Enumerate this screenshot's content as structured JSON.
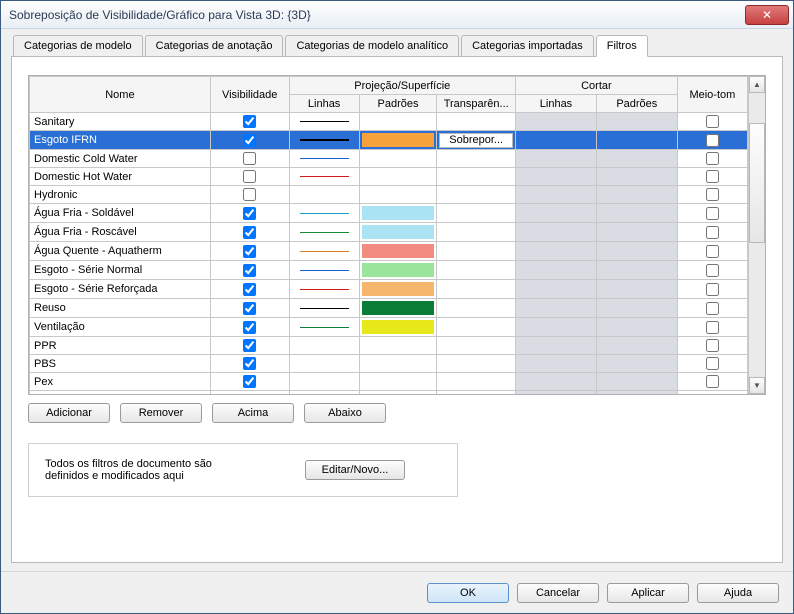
{
  "window": {
    "title": "Sobreposição de Visibilidade/Gráfico para Vista 3D: {3D}",
    "close": "✕"
  },
  "tabs": [
    {
      "label": "Categorias de modelo"
    },
    {
      "label": "Categorias de anotação"
    },
    {
      "label": "Categorias de modelo analítico"
    },
    {
      "label": "Categorias importadas"
    },
    {
      "label": "Filtros"
    }
  ],
  "columns": {
    "name": "Nome",
    "visibility": "Visibilidade",
    "projection": "Projeção/Superfície",
    "proj_lines": "Linhas",
    "proj_patterns": "Padrões",
    "proj_transp": "Transparên...",
    "cut": "Cortar",
    "cut_lines": "Linhas",
    "cut_patterns": "Padrões",
    "halftone": "Meio-tom"
  },
  "override_label": "Sobrepor...",
  "rows": [
    {
      "name": "Sanitary",
      "vis": true,
      "line": "#000000",
      "pattern": null,
      "half": false,
      "selected": false
    },
    {
      "name": "Esgoto IFRN",
      "vis": true,
      "line": "#000000",
      "pattern": "#f6a23a",
      "half": false,
      "selected": true,
      "line_thick": true
    },
    {
      "name": "Domestic Cold Water",
      "vis": false,
      "line": "#1560d6",
      "pattern": null,
      "half": false,
      "selected": false
    },
    {
      "name": "Domestic Hot Water",
      "vis": false,
      "line": "#d11a1a",
      "pattern": null,
      "half": false,
      "selected": false
    },
    {
      "name": "Hydronic",
      "vis": false,
      "line": null,
      "pattern": null,
      "half": false,
      "selected": false
    },
    {
      "name": "Água Fria - Soldável",
      "vis": true,
      "line": "#14a5c6",
      "pattern": "#a9e3f4",
      "half": false,
      "selected": false
    },
    {
      "name": "Água Fria - Roscável",
      "vis": true,
      "line": "#178a36",
      "pattern": "#a9e3f4",
      "half": false,
      "selected": false
    },
    {
      "name": "Água Quente - Aquatherm",
      "vis": true,
      "line": "#e07a1e",
      "pattern": "#f28c82",
      "half": false,
      "selected": false
    },
    {
      "name": "Esgoto - Série Normal",
      "vis": true,
      "line": "#1560d6",
      "pattern": "#9be49b",
      "half": false,
      "selected": false
    },
    {
      "name": "Esgoto - Série Reforçada",
      "vis": true,
      "line": "#d11a1a",
      "pattern": "#f5b56b",
      "half": false,
      "selected": false
    },
    {
      "name": "Reuso",
      "vis": true,
      "line": "#000000",
      "pattern": "#0b7d37",
      "half": false,
      "selected": false
    },
    {
      "name": "Ventilação",
      "vis": true,
      "line": "#0b7d37",
      "pattern": "#e6e81a",
      "half": false,
      "selected": false
    },
    {
      "name": "PPR",
      "vis": true,
      "line": null,
      "pattern": null,
      "half": false,
      "selected": false
    },
    {
      "name": "PBS",
      "vis": true,
      "line": null,
      "pattern": null,
      "half": false,
      "selected": false
    },
    {
      "name": "Pex",
      "vis": true,
      "line": null,
      "pattern": null,
      "half": false,
      "selected": false
    }
  ],
  "buttons": {
    "add": "Adicionar",
    "remove": "Remover",
    "up": "Acima",
    "down": "Abaixo",
    "edit_new": "Editar/Novo..."
  },
  "info_text": "Todos os filtros de documento são definidos e modificados aqui",
  "footer": {
    "ok": "OK",
    "cancel": "Cancelar",
    "apply": "Aplicar",
    "help": "Ajuda"
  }
}
